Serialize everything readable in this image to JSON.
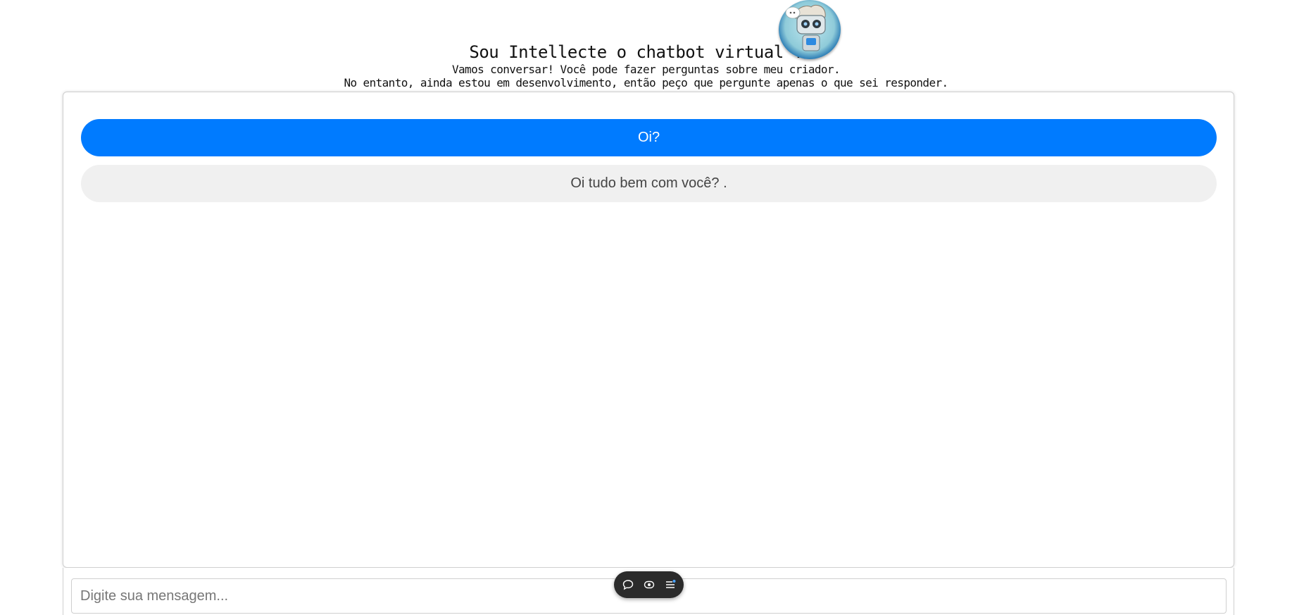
{
  "header": {
    "title": "Sou Intellecte o chatbot virtual !!!",
    "subtitle_line1": "Vamos conversar! Você pode fazer perguntas sobre meu criador.",
    "subtitle_line2": "No entanto, ainda estou em desenvolvimento, então peço que pergunte apenas o que sei responder.",
    "avatar_icon": "robot-avatar-icon"
  },
  "chat": {
    "messages": [
      {
        "role": "user",
        "text": "Oi?"
      },
      {
        "role": "bot",
        "text": "Oi tudo bem com você? ."
      }
    ]
  },
  "input": {
    "placeholder": "Digite sua mensagem..."
  },
  "toolbar": {
    "icons": [
      "chat-bubble-icon",
      "eye-icon",
      "menu-lines-icon"
    ]
  },
  "colors": {
    "user_bubble": "#007bff",
    "bot_bubble": "#f0f0f0",
    "avatar_ring": "#0a4f91",
    "toolbar_bg": "#2b2b2b"
  }
}
